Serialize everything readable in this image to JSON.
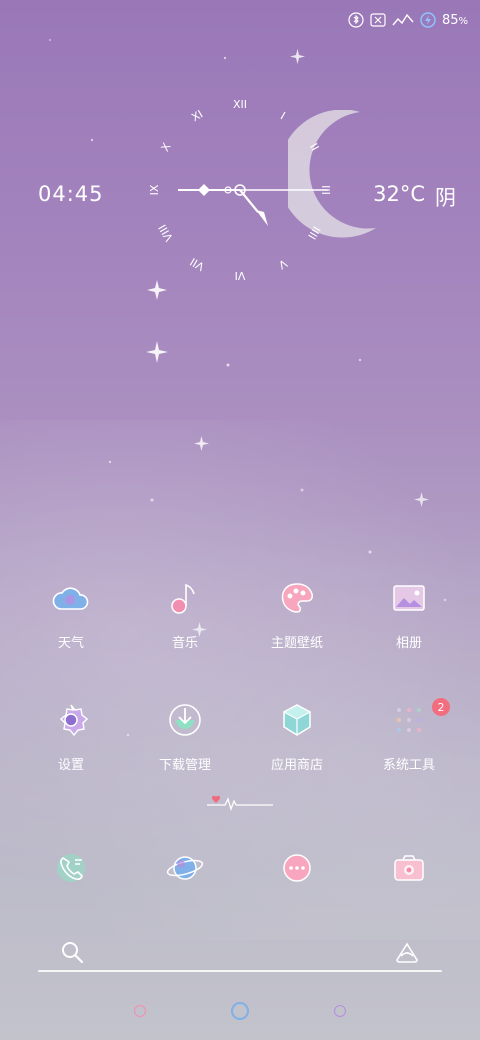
{
  "status_bar": {
    "battery_percent": "85",
    "battery_unit": "%",
    "icons": [
      "bluetooth-icon",
      "sim-x-icon",
      "signal-icon",
      "charging-icon"
    ]
  },
  "clock_widget": {
    "time": "04:45",
    "temperature": "32°C",
    "condition": "阴",
    "dial_numerals": [
      "XII",
      "I",
      "II",
      "III",
      "IIII",
      "V",
      "VI",
      "VII",
      "VIII",
      "IX",
      "X",
      "XI"
    ]
  },
  "apps": [
    {
      "label": "天气",
      "icon": "weather-cloud-icon"
    },
    {
      "label": "音乐",
      "icon": "music-note-icon"
    },
    {
      "label": "主题壁纸",
      "icon": "theme-palette-icon"
    },
    {
      "label": "相册",
      "icon": "gallery-icon"
    },
    {
      "label": "设置",
      "icon": "settings-gear-icon"
    },
    {
      "label": "下载管理",
      "icon": "download-icon"
    },
    {
      "label": "应用商店",
      "icon": "app-store-box-icon"
    },
    {
      "label": "系统工具",
      "icon": "system-tools-folder-icon",
      "badge": "2"
    }
  ],
  "dock": [
    {
      "icon": "phone-icon"
    },
    {
      "icon": "browser-planet-icon"
    },
    {
      "icon": "messages-icon"
    },
    {
      "icon": "camera-icon"
    }
  ],
  "search": {
    "icons": [
      "search-icon",
      "assistant-icon"
    ]
  },
  "colors": {
    "accent_pink": "#f28fb0",
    "accent_blue": "#7fb0e8",
    "accent_purple": "#b58fe0",
    "badge": "#f26d7d"
  }
}
